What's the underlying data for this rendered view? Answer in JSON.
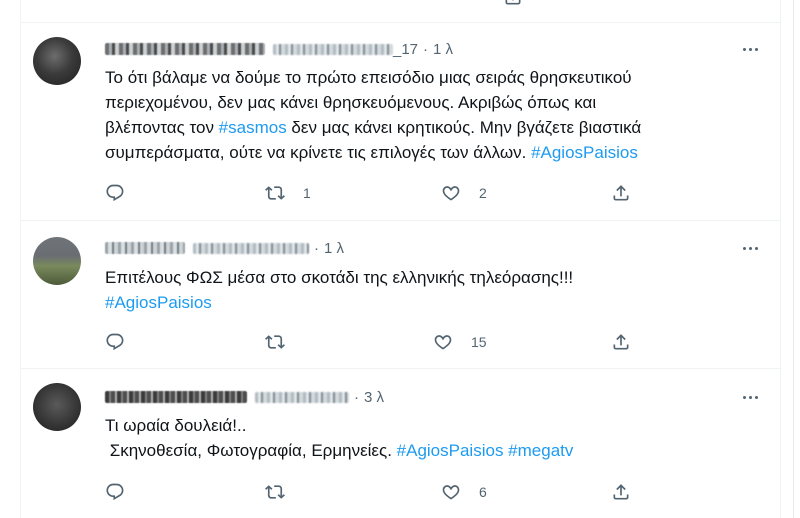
{
  "tweets": [
    {
      "timestamp": "1 λ",
      "handle_suffix": "_17",
      "text_lines": [
        [
          {
            "t": "Το ότι βάλαμε να δούμε το πρώτο επεισόδιο μιας σειράς θρησκευτικού"
          }
        ],
        [
          {
            "t": "περιεχομένου, δεν μας κάνει θρησκευόμενους. Ακριβώς όπως και"
          }
        ],
        [
          {
            "t": "βλέποντας τον "
          },
          {
            "t": "#sasmos",
            "tag": true
          },
          {
            "t": " δεν μας κάνει κρητικούς. Μην βγάζετε βιαστικά"
          }
        ],
        [
          {
            "t": "συμπεράσματα, ούτε να κρίνετε τις επιλογές των άλλων. "
          },
          {
            "t": "#AgiosPaisios",
            "tag": true
          }
        ]
      ],
      "reply_count": "",
      "retweet_count": "1",
      "like_count": "2"
    },
    {
      "timestamp": "1 λ",
      "handle_suffix": "",
      "text_lines": [
        [
          {
            "t": "Επιτέλους ΦΩΣ μέσα στο σκοτάδι της ελληνικής τηλεόρασης!!!"
          }
        ],
        [
          {
            "t": "#AgiosPaisios",
            "tag": true
          }
        ]
      ],
      "reply_count": "",
      "retweet_count": "",
      "like_count": "15"
    },
    {
      "timestamp": "3 λ",
      "handle_suffix": "",
      "text_lines": [
        [
          {
            "t": "Τι ωραία δουλειά!.."
          }
        ],
        [
          {
            "t": " Σκηνοθεσία, Φωτογραφία, Ερμηνείες. "
          },
          {
            "t": "#AgiosPaisios",
            "tag": true
          },
          {
            "t": " "
          },
          {
            "t": "#megatv",
            "tag": true
          }
        ]
      ],
      "reply_count": "",
      "retweet_count": "",
      "like_count": "6"
    }
  ],
  "icons": {
    "reply": "reply-icon",
    "retweet": "retweet-icon",
    "like": "heart-icon",
    "share": "share-icon",
    "more": "more-icon"
  },
  "colors": {
    "hashtag": "#1d9bf0",
    "secondary_text": "#536471",
    "primary_text": "#0f1419",
    "divider": "#eff3f4"
  }
}
